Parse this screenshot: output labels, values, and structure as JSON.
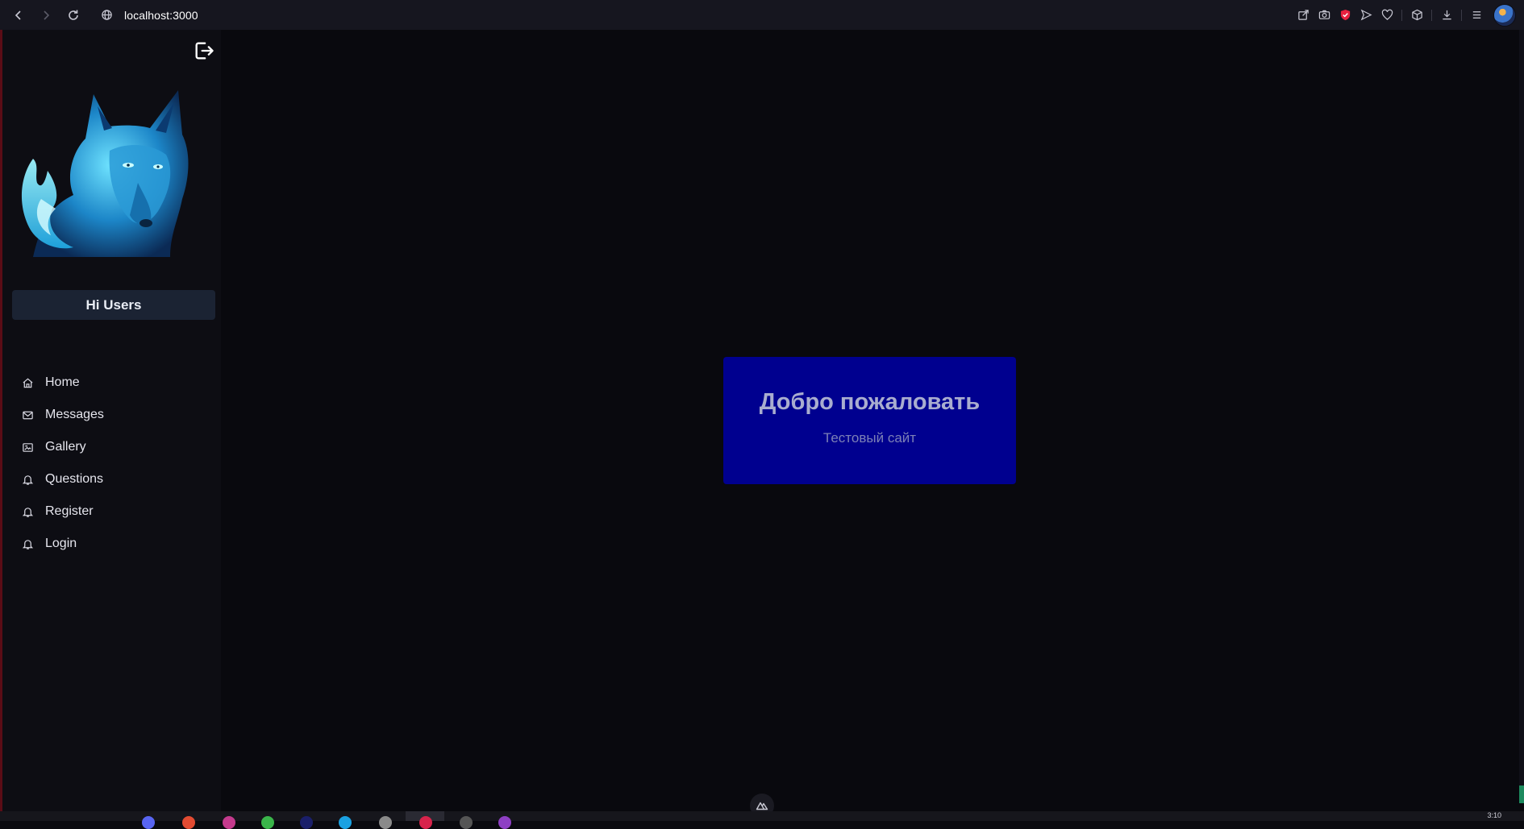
{
  "browser": {
    "url": "localhost:3000",
    "icons": [
      "back-icon",
      "forward-icon",
      "reload-icon",
      "globe-icon",
      "share-icon",
      "camera-icon",
      "shield-icon",
      "send-icon",
      "heart-icon",
      "box-icon",
      "download-icon",
      "menu-icon"
    ]
  },
  "sidebar": {
    "greeting": "Hi Users",
    "items": [
      {
        "label": "Home",
        "icon": "home-icon"
      },
      {
        "label": "Messages",
        "icon": "mail-icon"
      },
      {
        "label": "Gallery",
        "icon": "image-icon"
      },
      {
        "label": "Questions",
        "icon": "bell-icon"
      },
      {
        "label": "Register",
        "icon": "bell-icon"
      },
      {
        "label": "Login",
        "icon": "bell-icon"
      }
    ]
  },
  "main": {
    "title": "Добро пожаловать",
    "subtitle": "Тестовый сайт"
  },
  "taskbar": {
    "time": "3:10"
  },
  "colors": {
    "page_bg": "#09090e",
    "sidebar_bg": "#0d0d13",
    "card_bg": "#00008f",
    "greeting_bg": "#1b2333",
    "shield": "#e8213f"
  }
}
